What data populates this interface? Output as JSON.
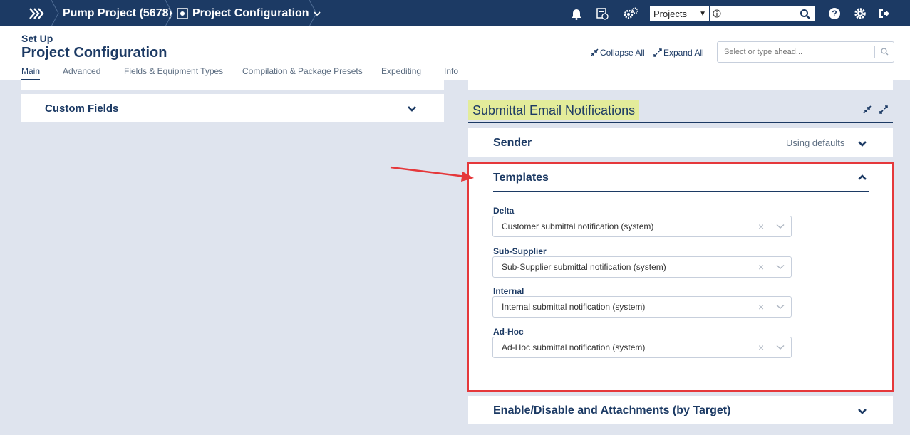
{
  "topbar": {
    "breadcrumbs": [
      {
        "label": "Pump Project (5678)"
      },
      {
        "label": "Project Configuration"
      }
    ],
    "project_selector": "Projects",
    "icons": [
      "menu-icon",
      "bell-icon",
      "calendar-icon",
      "cogs-icon",
      "search-icon",
      "help-icon",
      "gear-icon",
      "logout-icon"
    ]
  },
  "header": {
    "setup_label": "Set Up",
    "page_title": "Project Configuration",
    "collapse_all": "Collapse All",
    "expand_all": "Expand All",
    "search_placeholder": "Select or type ahead...",
    "tabs": [
      {
        "label": "Main",
        "active": true
      },
      {
        "label": "Advanced"
      },
      {
        "label": "Fields & Equipment Types"
      },
      {
        "label": "Compilation & Package Presets"
      },
      {
        "label": "Expediting"
      },
      {
        "label": "Info"
      }
    ]
  },
  "left": {
    "custom_fields": "Custom Fields"
  },
  "right": {
    "section_title": "Submittal Email Notifications",
    "sender": {
      "title": "Sender",
      "status": "Using defaults"
    },
    "templates": {
      "title": "Templates",
      "fields": [
        {
          "label": "Delta",
          "value": "Customer submittal notification (system)"
        },
        {
          "label": "Sub-Supplier",
          "value": "Sub-Supplier submittal notification (system)"
        },
        {
          "label": "Internal",
          "value": "Internal submittal notification (system)"
        },
        {
          "label": "Ad-Hoc",
          "value": "Ad-Hoc submittal notification (system)"
        }
      ],
      "clear_glyph": "×"
    },
    "enable_disable": "Enable/Disable and Attachments (by Target)"
  },
  "colors": {
    "navy": "#1c3a64",
    "highlight": "#e3ec9a",
    "annotation": "#e5383b",
    "background": "#dfe4ee"
  }
}
